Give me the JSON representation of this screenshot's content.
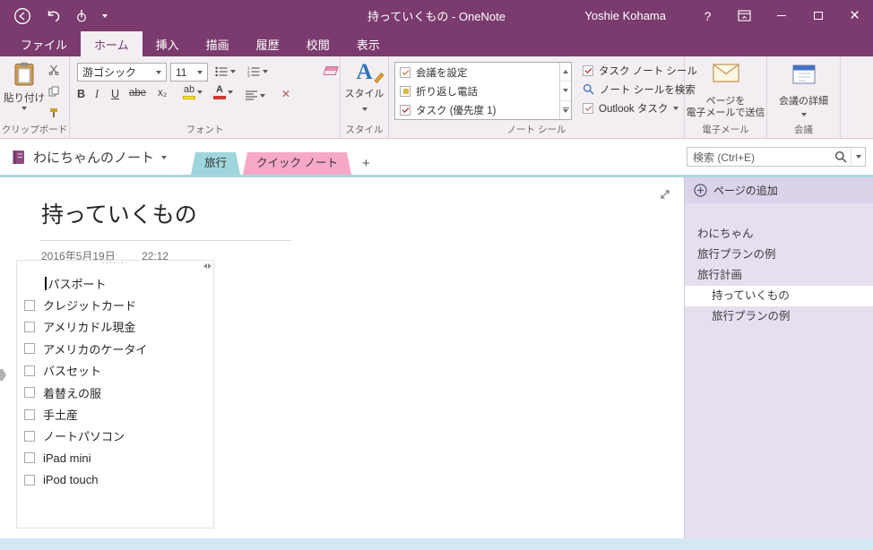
{
  "accents": {
    "titlebar_purple": "#7B3B6E",
    "ribbon_bg": "#F3EEF2",
    "section_travel_teal": "#9FD5DD",
    "section_quick_pink": "#F6A9C7",
    "sidebar_lavender": "#E5DFF0",
    "canvas_edge_blue": "#ABD6DF",
    "scroll_strip_blue": "#D4E8F4"
  },
  "titlebar": {
    "title": "持っていくもの - OneNote",
    "user": "Yoshie Kohama",
    "help": "?"
  },
  "ribbon_tabs": [
    {
      "label": "ファイル"
    },
    {
      "label": "ホーム"
    },
    {
      "label": "挿入"
    },
    {
      "label": "描画"
    },
    {
      "label": "履歴"
    },
    {
      "label": "校閲"
    },
    {
      "label": "表示"
    }
  ],
  "ribbon": {
    "clipboard": {
      "paste_label": "貼り付け",
      "group_label": "クリップボード"
    },
    "font": {
      "family": "游ゴシック",
      "size": "11",
      "bold": "B",
      "italic": "I",
      "underline": "U",
      "strike": "abe",
      "subscript": "x₂",
      "highlight": "ab",
      "color_a": "A",
      "clear": "✕",
      "group_label": "フォント"
    },
    "styles": {
      "big_a": "A",
      "label": "スタイル",
      "group_label": "スタイル"
    },
    "tags": {
      "list": [
        {
          "label": "会議を設定"
        },
        {
          "label": "折り返し電話"
        },
        {
          "label": "タスク (優先度 1)"
        }
      ],
      "task_tag": "タスク ノート シール",
      "find_tags": "ノート シールを検索",
      "outlook_tasks": "Outlook タスク",
      "group_label": "ノート シール"
    },
    "email": {
      "line1": "ページを",
      "line2": "電子メールで送信",
      "group_label": "電子メール"
    },
    "meeting": {
      "label": "会議の詳細",
      "group_label": "会議"
    }
  },
  "navbar": {
    "notebook": "わにちゃんのノート",
    "sections": [
      {
        "label": "旅行"
      },
      {
        "label": "クイック ノート"
      }
    ],
    "add_section": "+",
    "search_placeholder": "検索 (Ctrl+E)"
  },
  "page": {
    "title": "持っていくもの",
    "date": "2016年5月19日",
    "time": "22:12",
    "items": [
      {
        "text": "パスポート"
      },
      {
        "text": "クレジットカード"
      },
      {
        "text": "アメリカドル現金"
      },
      {
        "text": "アメリカのケータイ"
      },
      {
        "text": "バスセット"
      },
      {
        "text": "着替えの服"
      },
      {
        "text": "手土産"
      },
      {
        "text": "ノートパソコン"
      },
      {
        "text": "iPad mini"
      },
      {
        "text": "iPod touch"
      }
    ]
  },
  "sidebar": {
    "add_page": "ページの追加",
    "pages": [
      {
        "label": "わにちゃん"
      },
      {
        "label": "旅行プランの例"
      },
      {
        "label": "旅行計画"
      },
      {
        "label": "持っていくもの"
      },
      {
        "label": "旅行プランの例"
      }
    ]
  }
}
